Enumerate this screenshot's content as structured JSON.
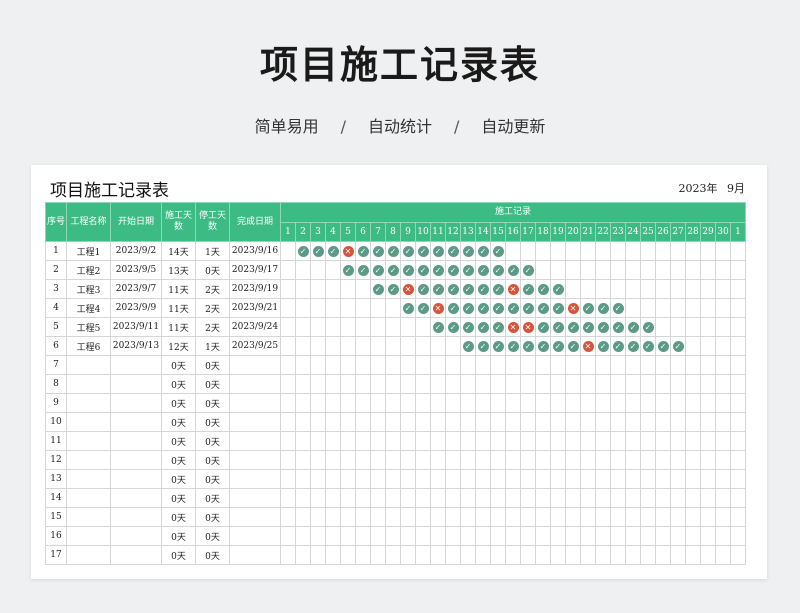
{
  "hero": {
    "title": "项目施工记录表",
    "subtitle_parts": [
      "简单易用",
      "自动统计",
      "自动更新"
    ],
    "separator": "/"
  },
  "sheet": {
    "title": "项目施工记录表",
    "year": "2023年",
    "month": "9月",
    "headers": {
      "seq": "序号",
      "name": "工程名称",
      "start": "开始日期",
      "days": "施工天数",
      "stop": "停工天数",
      "done": "完成日期",
      "record": "施工记录"
    },
    "day_labels": [
      "1",
      "2",
      "3",
      "4",
      "5",
      "6",
      "7",
      "8",
      "9",
      "10",
      "11",
      "12",
      "13",
      "14",
      "15",
      "16",
      "17",
      "18",
      "19",
      "20",
      "21",
      "22",
      "23",
      "24",
      "25",
      "26",
      "27",
      "28",
      "29",
      "30",
      "1"
    ],
    "rows": [
      {
        "no": "1",
        "name": "工程1",
        "start": "2023/9/2",
        "days": "14天",
        "stop": "1天",
        "done": "2023/9/16",
        "marks": "-oooxoooooooooo----------------"
      },
      {
        "no": "2",
        "name": "工程2",
        "start": "2023/9/5",
        "days": "13天",
        "stop": "0天",
        "done": "2023/9/17",
        "marks": "----ooooooooooooo--------------"
      },
      {
        "no": "3",
        "name": "工程3",
        "start": "2023/9/7",
        "days": "11天",
        "stop": "2天",
        "done": "2023/9/19",
        "marks": "------ooxooooooxooo------------"
      },
      {
        "no": "4",
        "name": "工程4",
        "start": "2023/9/9",
        "days": "11天",
        "stop": "2天",
        "done": "2023/9/21",
        "marks": "--------ooxooooooooxooo--------"
      },
      {
        "no": "5",
        "name": "工程5",
        "start": "2023/9/11",
        "days": "11天",
        "stop": "2天",
        "done": "2023/9/24",
        "marks": "----------oooooxxoooooooo------"
      },
      {
        "no": "6",
        "name": "工程6",
        "start": "2023/9/13",
        "days": "12天",
        "stop": "1天",
        "done": "2023/9/25",
        "marks": "------------ooooooooxoooooo----"
      },
      {
        "no": "7",
        "name": "",
        "start": "",
        "days": "0天",
        "stop": "0天",
        "done": "",
        "marks": ""
      },
      {
        "no": "8",
        "name": "",
        "start": "",
        "days": "0天",
        "stop": "0天",
        "done": "",
        "marks": ""
      },
      {
        "no": "9",
        "name": "",
        "start": "",
        "days": "0天",
        "stop": "0天",
        "done": "",
        "marks": ""
      },
      {
        "no": "10",
        "name": "",
        "start": "",
        "days": "0天",
        "stop": "0天",
        "done": "",
        "marks": ""
      },
      {
        "no": "11",
        "name": "",
        "start": "",
        "days": "0天",
        "stop": "0天",
        "done": "",
        "marks": ""
      },
      {
        "no": "12",
        "name": "",
        "start": "",
        "days": "0天",
        "stop": "0天",
        "done": "",
        "marks": ""
      },
      {
        "no": "13",
        "name": "",
        "start": "",
        "days": "0天",
        "stop": "0天",
        "done": "",
        "marks": ""
      },
      {
        "no": "14",
        "name": "",
        "start": "",
        "days": "0天",
        "stop": "0天",
        "done": "",
        "marks": ""
      },
      {
        "no": "15",
        "name": "",
        "start": "",
        "days": "0天",
        "stop": "0天",
        "done": "",
        "marks": ""
      },
      {
        "no": "16",
        "name": "",
        "start": "",
        "days": "0天",
        "stop": "0天",
        "done": "",
        "marks": ""
      },
      {
        "no": "17",
        "name": "",
        "start": "",
        "days": "0天",
        "stop": "0天",
        "done": "",
        "marks": ""
      }
    ]
  },
  "colors": {
    "header_green": "#3dbb85",
    "check_mark": "#5b9a86",
    "cross_mark": "#d9533a"
  },
  "icons": {
    "done": "check-circle-icon",
    "stopped": "cross-circle-icon"
  }
}
